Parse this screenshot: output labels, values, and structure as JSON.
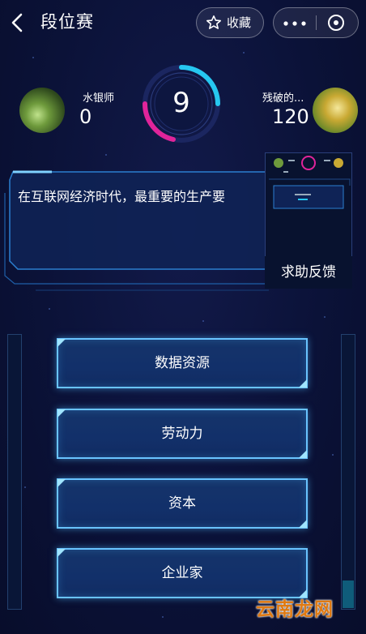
{
  "header": {
    "title": "段位赛",
    "favorite_label": "收藏"
  },
  "players": {
    "left": {
      "name": "水银师",
      "score": "0"
    },
    "right": {
      "name": "残破的...",
      "score": "120"
    }
  },
  "timer": {
    "seconds": "9"
  },
  "question": {
    "text": "在互联网经济时代，最重要的生产要"
  },
  "help": {
    "label": "求助反馈"
  },
  "options": [
    {
      "label": "数据资源"
    },
    {
      "label": "劳动力"
    },
    {
      "label": "资本"
    },
    {
      "label": "企业家"
    }
  ],
  "watermark": "云南龙网",
  "colors": {
    "accent": "#69c3ff",
    "timer_pink": "#e0249a",
    "timer_cyan": "#26c7f0",
    "background": "#0b1238",
    "watermark": "#e07a12"
  },
  "icons": {
    "back": "chevron-left-icon",
    "favorite": "star-outline-icon",
    "more": "more-dots-icon",
    "close": "close-target-icon"
  }
}
